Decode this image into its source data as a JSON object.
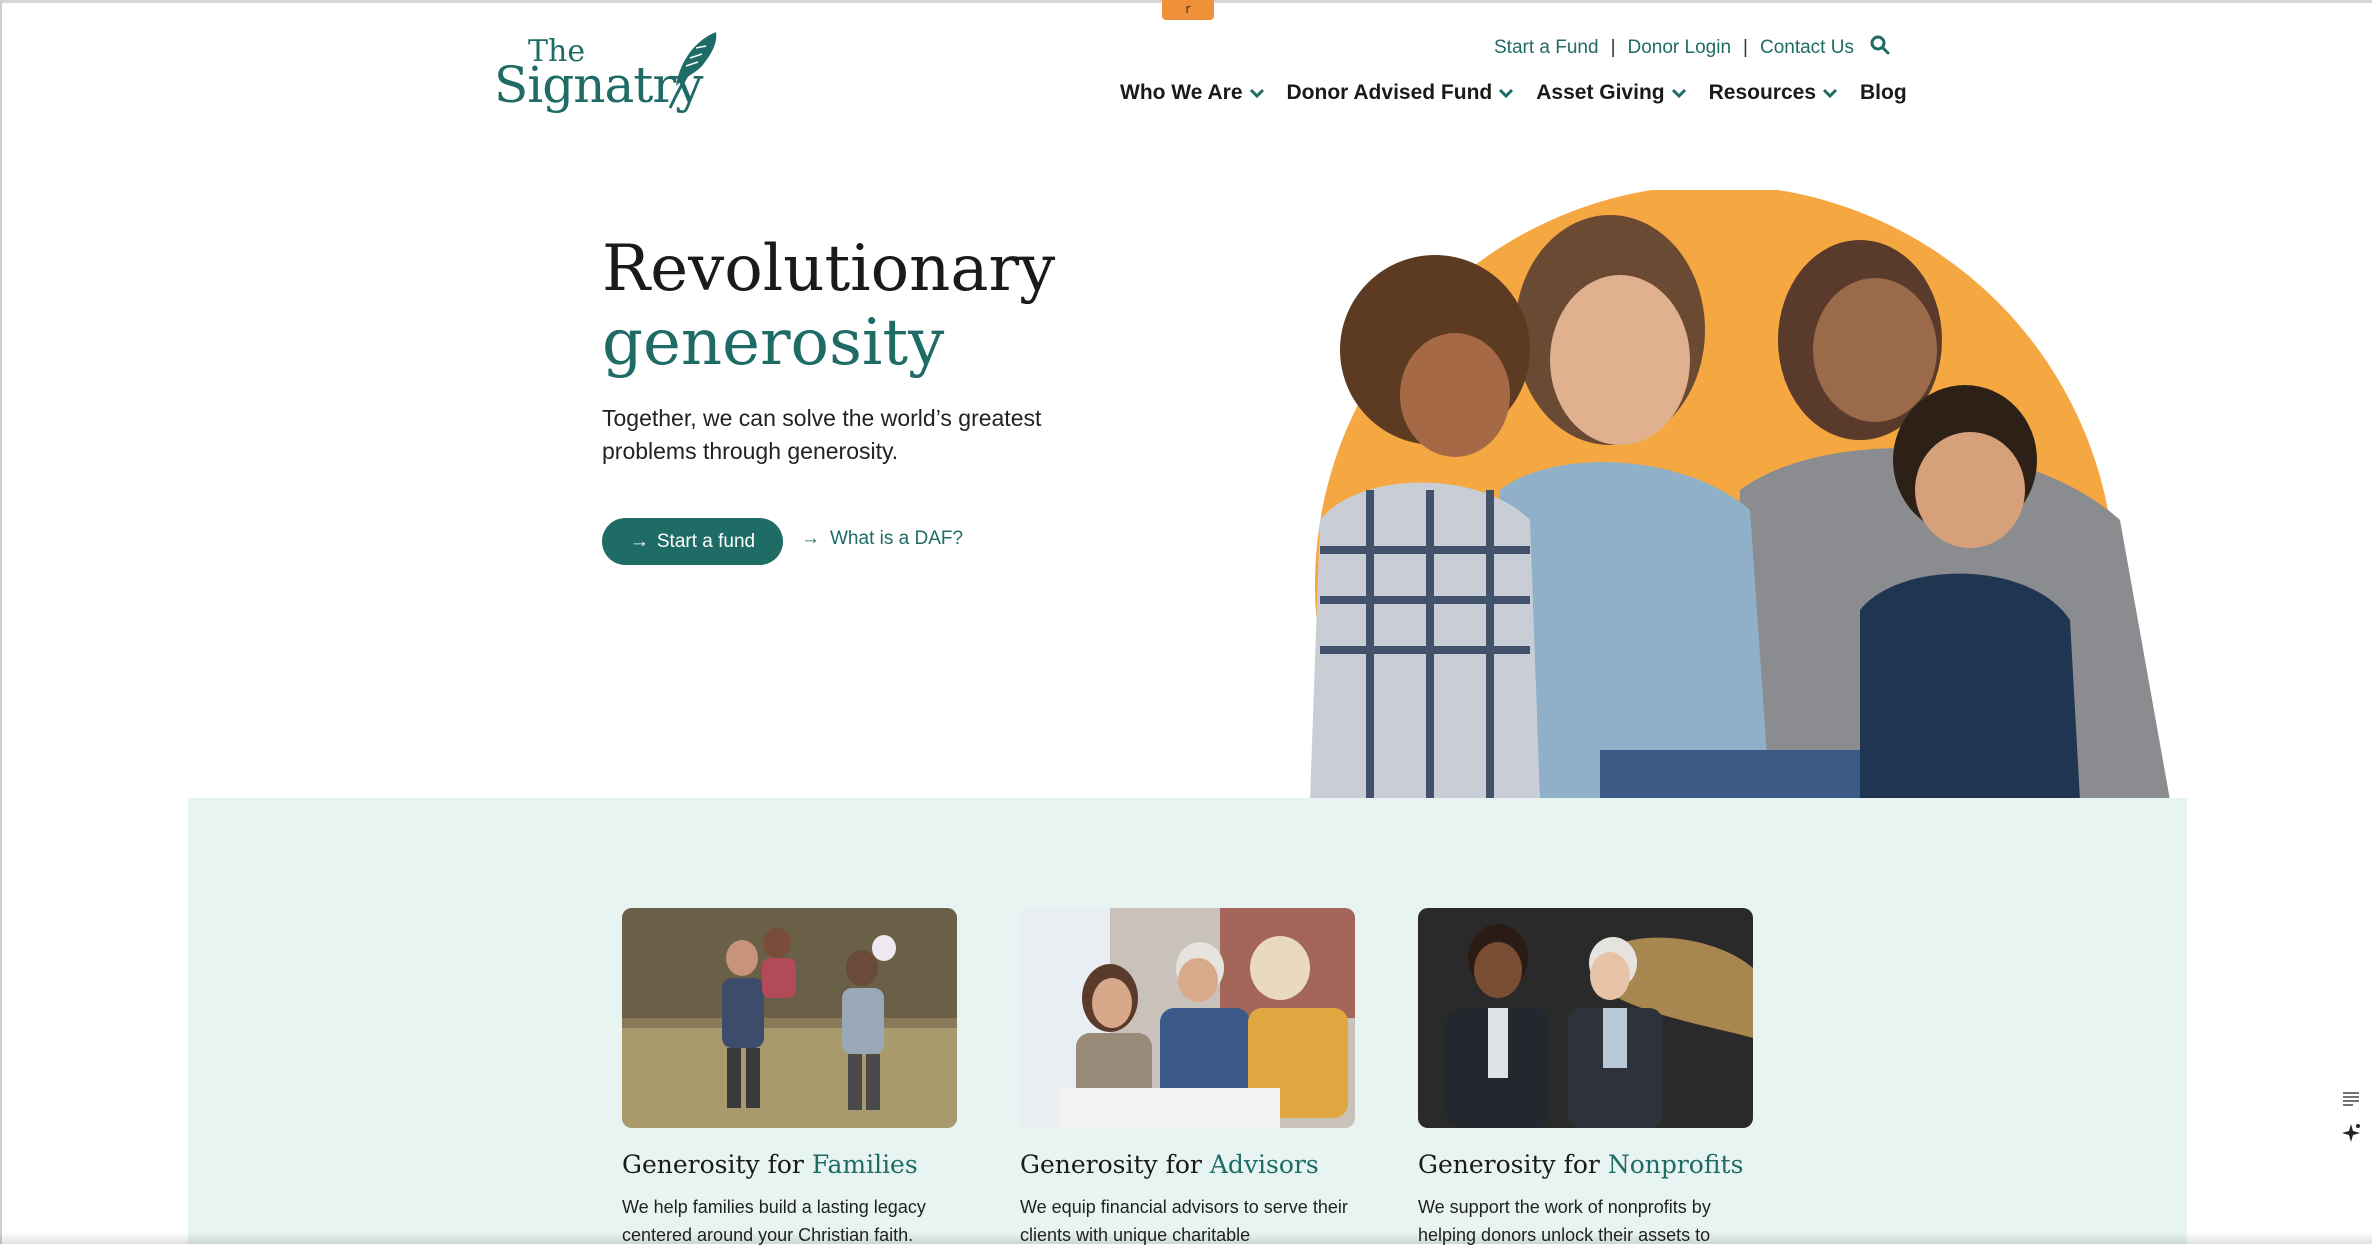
{
  "tab_marker": "r",
  "logo": {
    "the": "The",
    "word": "Signatry"
  },
  "utility_nav": {
    "start_fund": "Start a Fund",
    "donor_login": "Donor Login",
    "contact": "Contact Us",
    "separator": "|",
    "search_icon": "search-icon"
  },
  "main_nav": {
    "items": [
      {
        "label": "Who We Are",
        "has_dropdown": true
      },
      {
        "label": "Donor Advised Fund",
        "has_dropdown": true
      },
      {
        "label": "Asset Giving",
        "has_dropdown": true
      },
      {
        "label": "Resources",
        "has_dropdown": true
      },
      {
        "label": "Blog",
        "has_dropdown": false
      }
    ]
  },
  "hero": {
    "title_line1": "Revolutionary",
    "title_line2": "generosity",
    "subtitle": "Together, we can solve the world’s greatest problems through generosity.",
    "primary_cta": "Start a fund",
    "secondary_cta": "What is a DAF?",
    "arrow": "→"
  },
  "audience_cards": [
    {
      "prefix": "Generosity for ",
      "highlight": "Families",
      "body": "We help families build a lasting legacy centered around your Christian faith."
    },
    {
      "prefix": "Generosity for ",
      "highlight": "Advisors",
      "body": "We equip financial advisors to serve their clients with unique charitable"
    },
    {
      "prefix": "Generosity for ",
      "highlight": "Nonprofits",
      "body": "We support the work of nonprofits by helping donors unlock their assets to"
    }
  ],
  "colors": {
    "brand_teal": "#1f6b66",
    "accent_orange": "#f5a742",
    "band_bg": "#e8f4f2"
  }
}
